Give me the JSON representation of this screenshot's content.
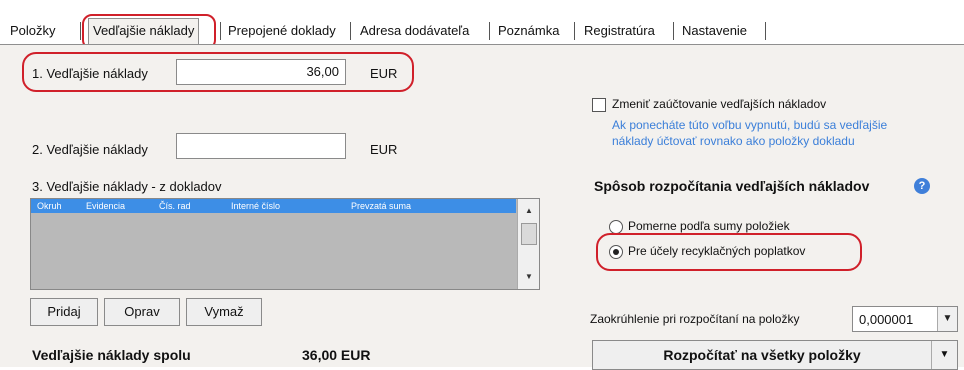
{
  "tabs": [
    {
      "label": "Položky"
    },
    {
      "label": "Vedľajšie náklady"
    },
    {
      "label": "Prepojené doklady"
    },
    {
      "label": "Adresa dodávateľa"
    },
    {
      "label": "Poznámka"
    },
    {
      "label": "Registratúra"
    },
    {
      "label": "Nastavenie"
    }
  ],
  "cost1": {
    "label": "1. Vedľajšie náklady",
    "value": "36,00",
    "currency": "EUR"
  },
  "cost2": {
    "label": "2. Vedľajšie náklady",
    "value": "",
    "currency": "EUR"
  },
  "cost3": {
    "label": "3. Vedľajšie náklady - z dokladov",
    "columns": [
      "Okruh",
      "Evidencia",
      "Čís. rad",
      "Interné číslo",
      "Prevzatá suma"
    ]
  },
  "buttons": {
    "add": "Pridaj",
    "edit": "Oprav",
    "delete": "Vymaž"
  },
  "total": {
    "label": "Vedľajšie náklady spolu",
    "value": "36,00 EUR"
  },
  "change_posting": {
    "label": "Zmeniť zaúčtovanie vedľajších nákladov",
    "checked": false,
    "hint_line1": "Ak ponecháte túto voľbu vypnutú, budú sa vedľajšie",
    "hint_line2": "náklady účtovať rovnako ako položky dokladu"
  },
  "allocation": {
    "title": "Spôsob rozpočítania vedľajších nákladov",
    "options": [
      {
        "label": "Pomerne podľa sumy položiek",
        "checked": false
      },
      {
        "label": "Pre účely recyklačných poplatkov",
        "checked": true
      }
    ]
  },
  "rounding": {
    "label": "Zaokrúhlenie pri rozpočítaní na položky",
    "value": "0,000001"
  },
  "distribute_button": "Rozpočítať na všetky položky",
  "colors": {
    "annotation": "#d0202a",
    "link_hint": "#3b7fd9",
    "grid_header": "#3d8ee6",
    "panel": "#f3f1ee"
  }
}
